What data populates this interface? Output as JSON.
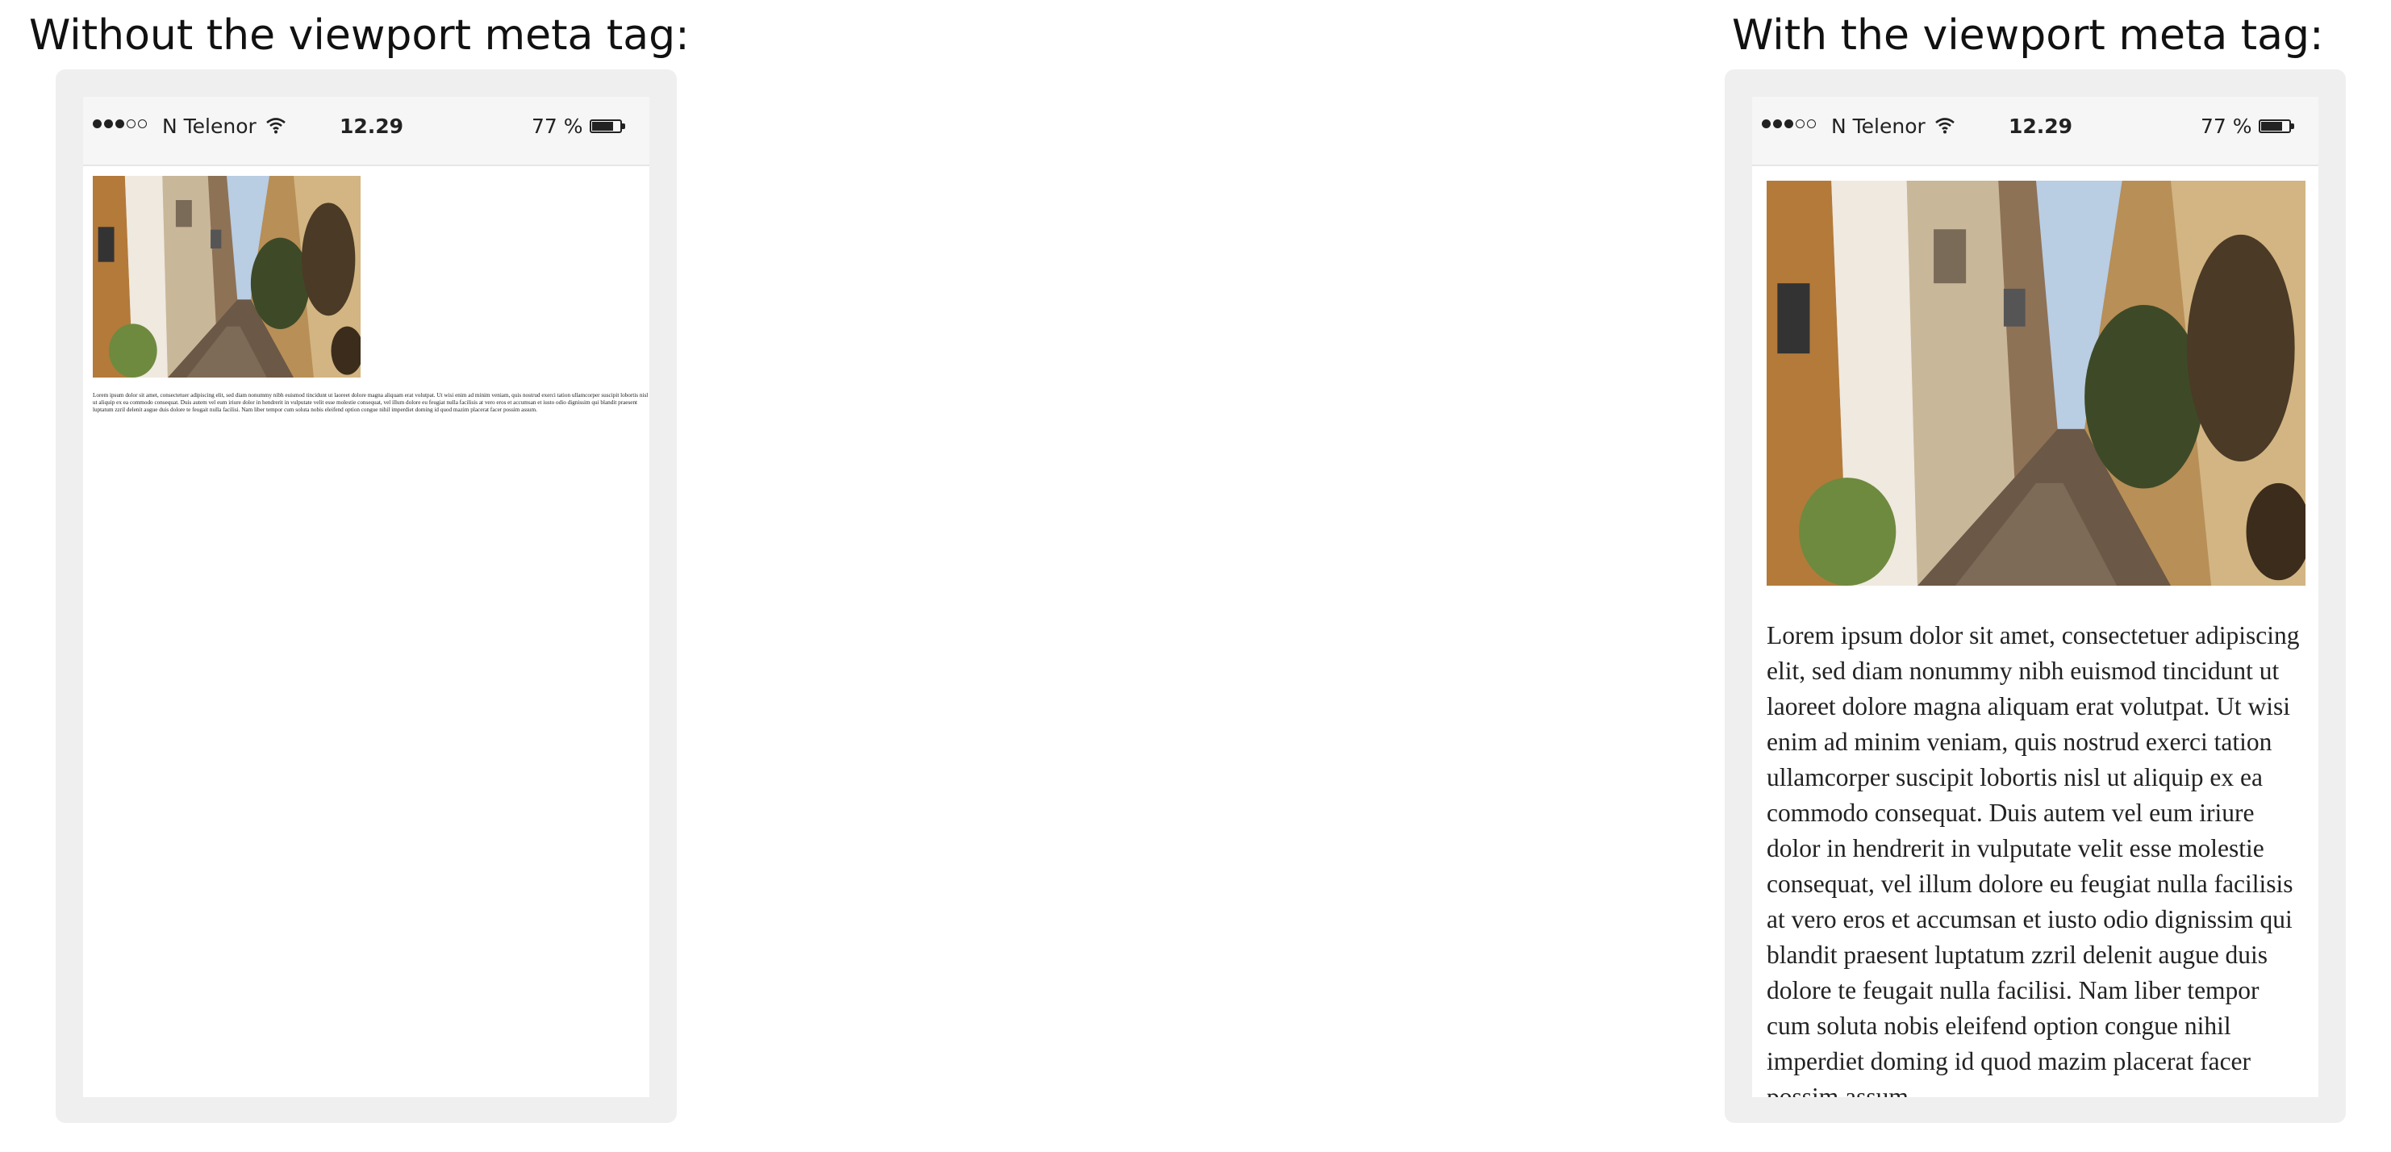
{
  "captions": {
    "left": "Without the viewport meta tag:",
    "right": "With the viewport meta tag:"
  },
  "statusbar": {
    "signal_dots": {
      "filled": 3,
      "empty": 2
    },
    "carrier": "N Telenor",
    "wifi_icon": "wifi-icon",
    "time": "12.29",
    "battery_percent": "77 %",
    "battery_level": 0.77
  },
  "content": {
    "photo_icon": "street-photo",
    "lorem": "Lorem ipsum dolor sit amet, consectetuer adipiscing elit, sed diam nonummy nibh euismod tincidunt ut laoreet dolore magna aliquam erat volutpat. Ut wisi enim ad minim veniam, quis nostrud exerci tation ullamcorper suscipit lobortis nisl ut aliquip ex ea commodo consequat. Duis autem vel eum iriure dolor in hendrerit in vulputate velit esse molestie consequat, vel illum dolore eu feugiat nulla facilisis at vero eros et accumsan et iusto odio dignissim qui blandit praesent luptatum zzril delenit augue duis dolore te feugait nulla facilisi. Nam liber tempor cum soluta nobis eleifend option congue nihil imperdiet doming id quod mazim placerat facer possim assum."
  },
  "colors": {
    "phone_frame": "#efefef",
    "statusbar_bg": "#f6f6f6",
    "text": "#222222"
  }
}
